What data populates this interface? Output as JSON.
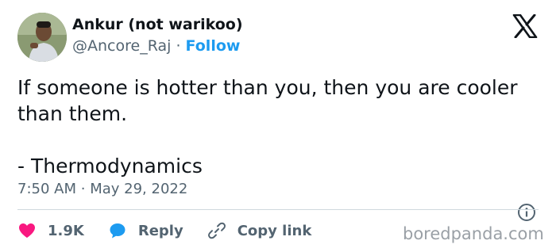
{
  "author": {
    "name": "Ankur (not warikoo)",
    "handle": "@Ancore_Raj",
    "separator": "·",
    "follow_label": "Follow"
  },
  "tweet": {
    "line1": "If someone is hotter than you, then you are cooler than them.",
    "line2": "- Thermodynamics"
  },
  "meta": {
    "time": "7:50 AM",
    "separator": "·",
    "date": "May 29, 2022"
  },
  "actions": {
    "likes_count": "1.9K",
    "reply_label": "Reply",
    "copy_link_label": "Copy link"
  },
  "watermark": "boredpanda.com",
  "colors": {
    "accent": "#1d9bf0",
    "like": "#f91880",
    "text": "#0f1419",
    "secondary": "#536471"
  },
  "icons": {
    "brand": "x-logo-icon",
    "info": "info-icon",
    "like": "heart-icon",
    "reply": "reply-bubble-icon",
    "copy_link": "link-icon"
  }
}
